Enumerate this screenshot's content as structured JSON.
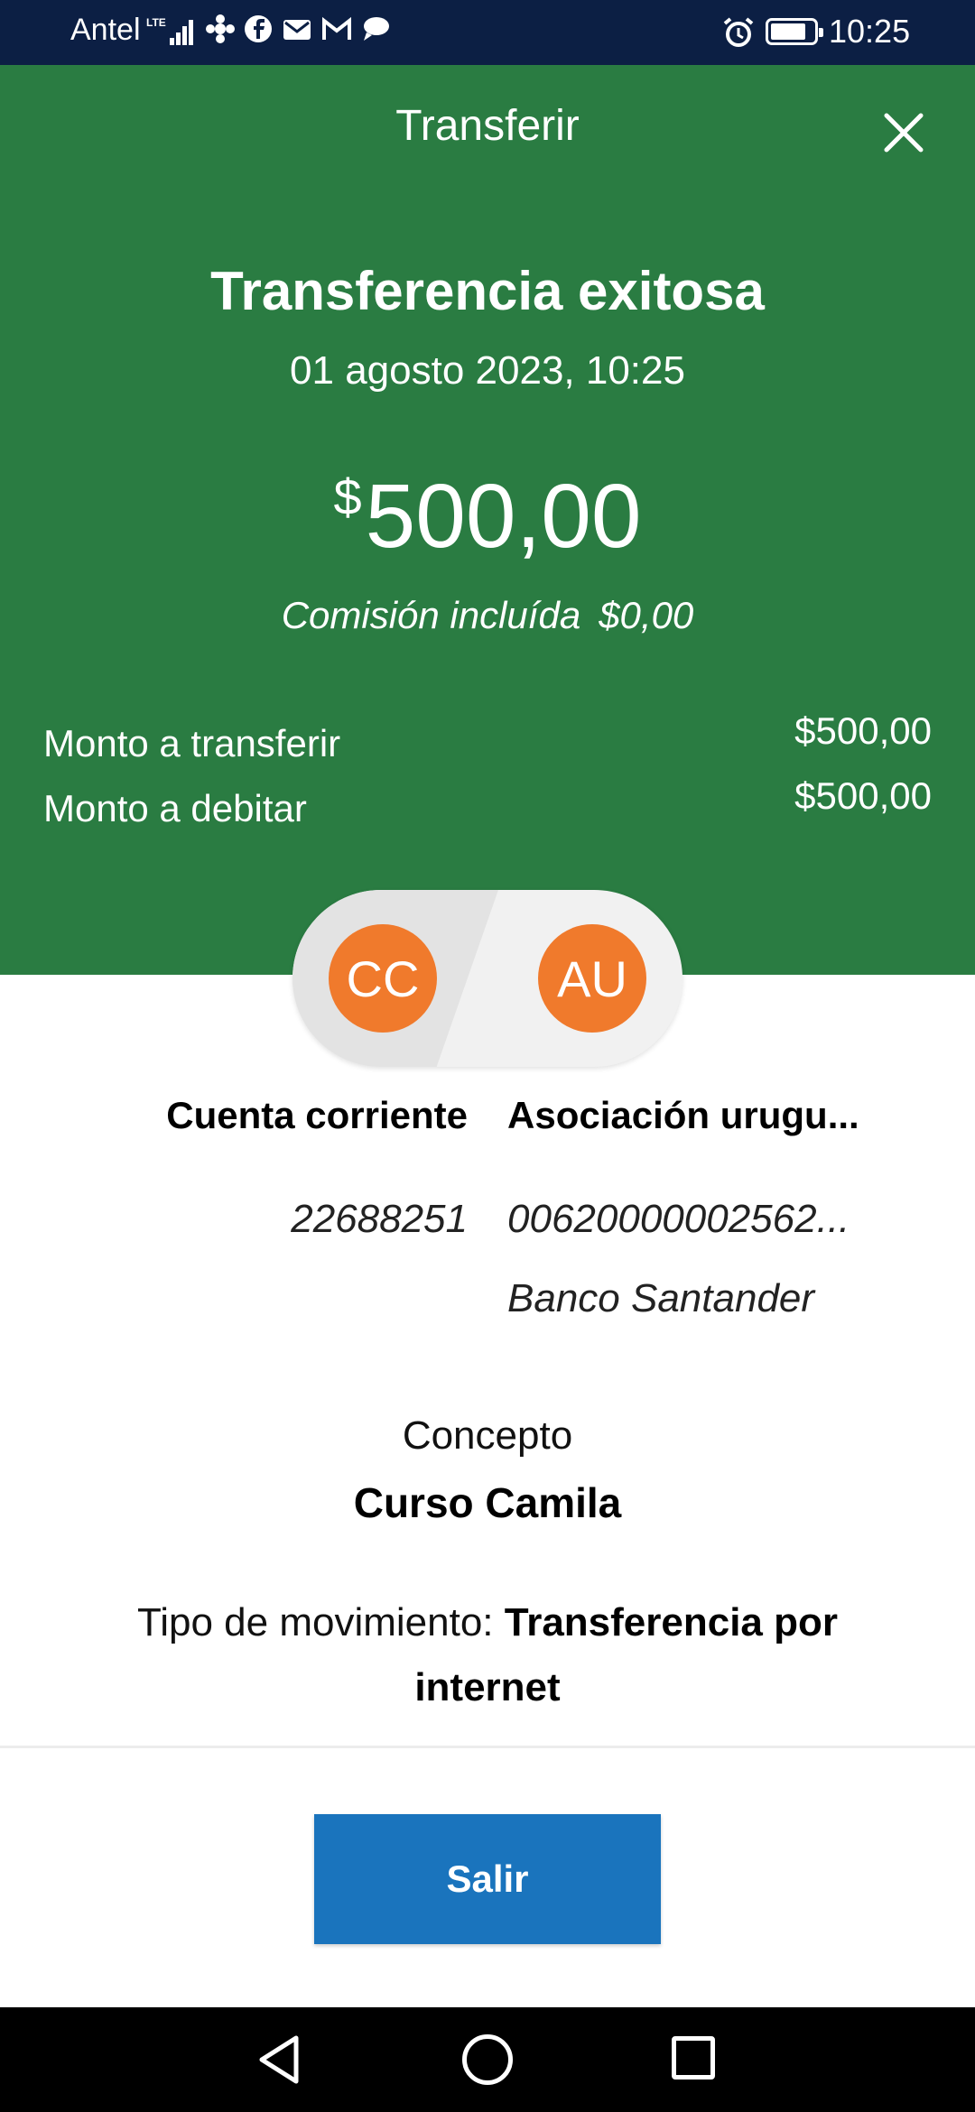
{
  "status_bar": {
    "carrier": "Antel",
    "network": "LTE",
    "time": "10:25",
    "icons": [
      "signal-icon",
      "app-notification-icon",
      "facebook-icon",
      "mail-icon",
      "gmail-icon",
      "message-icon",
      "alarm-icon",
      "battery-icon"
    ]
  },
  "header": {
    "title": "Transferir",
    "close_icon": "close-icon"
  },
  "result": {
    "title": "Transferencia exitosa",
    "datetime": "01 agosto 2023, 10:25",
    "currency_symbol": "$",
    "amount": "500,00",
    "commission_label": "Comisión incluída",
    "commission_value": "$0,00"
  },
  "summary": [
    {
      "label": "Monto a transferir",
      "value": "$500,00"
    },
    {
      "label": "Monto a debitar",
      "value": "$500,00"
    }
  ],
  "accounts": {
    "from": {
      "initials": "CC",
      "name": "Cuenta corriente",
      "number": "22688251"
    },
    "to": {
      "initials": "AU",
      "name": "Asociación urugu...",
      "number": "00620000002562...",
      "bank": "Banco Santander"
    },
    "avatar_color": "#f07a2c"
  },
  "concept": {
    "label": "Concepto",
    "value": "Curso Camila"
  },
  "movement": {
    "label": "Tipo de movimiento:",
    "value": "Transferencia por internet"
  },
  "actions": {
    "exit_label": "Salir"
  },
  "colors": {
    "header_green": "#2a7c42",
    "status_bar": "#0c1f44",
    "primary_button": "#1a74bd"
  },
  "nav_bar": {
    "icons": [
      "back-icon",
      "home-icon",
      "recents-icon"
    ]
  }
}
